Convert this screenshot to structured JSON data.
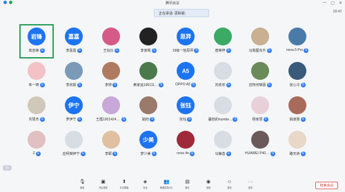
{
  "window": {
    "title": "腾讯会议",
    "controls": [
      "—",
      "▢",
      "✕"
    ]
  },
  "speaking_label": "正在讲话: 思聆歌;",
  "clock": "18:42",
  "participants": [
    {
      "name": "高岩锋",
      "avatar_text": "岩锋",
      "avatar_color": "#1c74f0",
      "active": true
    },
    {
      "name": "李嘉嘉",
      "avatar_text": "嘉嘉",
      "avatar_color": "#1c74f0"
    },
    {
      "name": "王钰仪",
      "avatar_text": "",
      "avatar_color": "#d65a88"
    },
    {
      "name": "李家辉",
      "avatar_text": "",
      "avatar_color": "#222222"
    },
    {
      "name": "19级一班思羿",
      "avatar_text": "思羿",
      "avatar_color": "#1c74f0"
    },
    {
      "name": "唐荣梓",
      "avatar_text": "",
      "avatar_color": "#3aaa64"
    },
    {
      "name": "马我图东升",
      "avatar_text": "",
      "avatar_color": "#c8b090"
    },
    {
      "name": "nova 5 Pro",
      "avatar_text": "",
      "avatar_color": "#4a7aa8"
    },
    {
      "name": "朱一琦",
      "avatar_text": "",
      "avatar_color": "#f2c2c6"
    },
    {
      "name": "李欣颜",
      "avatar_text": "",
      "avatar_color": "#7a9ab8"
    },
    {
      "name": "李婷",
      "avatar_text": "",
      "avatar_color": "#b07a60"
    },
    {
      "name": "黄家运1901114...",
      "avatar_text": "",
      "avatar_color": "#4a7a4a"
    },
    {
      "name": "OPPO A5",
      "avatar_text": "A5",
      "avatar_color": "#1c74f0"
    },
    {
      "name": "刘欢欢",
      "avatar_text": "",
      "avatar_color": "#d8dde3"
    },
    {
      "name": "应特河琳嘉",
      "avatar_text": "",
      "avatar_color": "#6a8a5a"
    },
    {
      "name": "张心冷",
      "avatar_text": "",
      "avatar_color": "#3a5a7a"
    },
    {
      "name": "刘慧杰",
      "avatar_text": "",
      "avatar_color": "#d0c8b8"
    },
    {
      "name": "罗伊宁",
      "avatar_text": "伊宁",
      "avatar_color": "#1c74f0"
    },
    {
      "name": "王霞1901424074",
      "avatar_text": "",
      "avatar_color": "#c8a8d8"
    },
    {
      "name": "蹈纷",
      "avatar_text": "",
      "avatar_color": "#9a7a6a"
    },
    {
      "name": "张钰",
      "avatar_text": "张钰",
      "avatar_color": "#1c74f0"
    },
    {
      "name": "暮他的numbe...",
      "avatar_text": "",
      "avatar_color": "#d8dde3"
    },
    {
      "name": "杨家慧",
      "avatar_text": "",
      "avatar_color": "#e8d0d8"
    },
    {
      "name": "姚淑惠",
      "avatar_text": "",
      "avatar_color": "#a86a5a"
    },
    {
      "name": "Z",
      "avatar_text": "",
      "avatar_color": "#e0c0c0"
    },
    {
      "name": "应柯琳伊宁",
      "avatar_text": "",
      "avatar_color": "#d8dde3"
    },
    {
      "name": "李颖",
      "avatar_text": "",
      "avatar_color": "#e0c0a0"
    },
    {
      "name": "梦少美",
      "avatar_text": "少美",
      "avatar_color": "#1c74f0"
    },
    {
      "name": "nova 4e",
      "avatar_text": "",
      "avatar_color": "#a02a3a"
    },
    {
      "name": "马静善",
      "avatar_text": "",
      "avatar_color": "#d8dde3"
    },
    {
      "name": "HUAWEI P40 P...",
      "avatar_text": "",
      "avatar_color": "#6a5a5a"
    },
    {
      "name": "路天娇",
      "avatar_text": "",
      "avatar_color": "#e8d8c8"
    }
  ],
  "toolbar": {
    "items": [
      {
        "label": "静音",
        "icon": "mic-icon",
        "glyph": "🎙"
      },
      {
        "label": "开启视频",
        "icon": "camera-icon",
        "glyph": "▣"
      },
      {
        "label": "共享屏幕",
        "icon": "share-screen-icon",
        "glyph": "⬆"
      },
      {
        "label": "安全",
        "icon": "shield-icon",
        "glyph": "◈"
      },
      {
        "label": "管理成员(32)",
        "icon": "members-icon",
        "glyph": "👥"
      },
      {
        "label": "聊天",
        "icon": "chat-icon",
        "glyph": "▤"
      },
      {
        "label": "录制",
        "icon": "record-icon",
        "glyph": "◉"
      },
      {
        "label": "表情",
        "icon": "emoji-icon",
        "glyph": "☺"
      },
      {
        "label": "更多",
        "icon": "more-icon",
        "glyph": "···"
      }
    ],
    "end_label": "结束会议"
  },
  "corner_button": "⊡"
}
